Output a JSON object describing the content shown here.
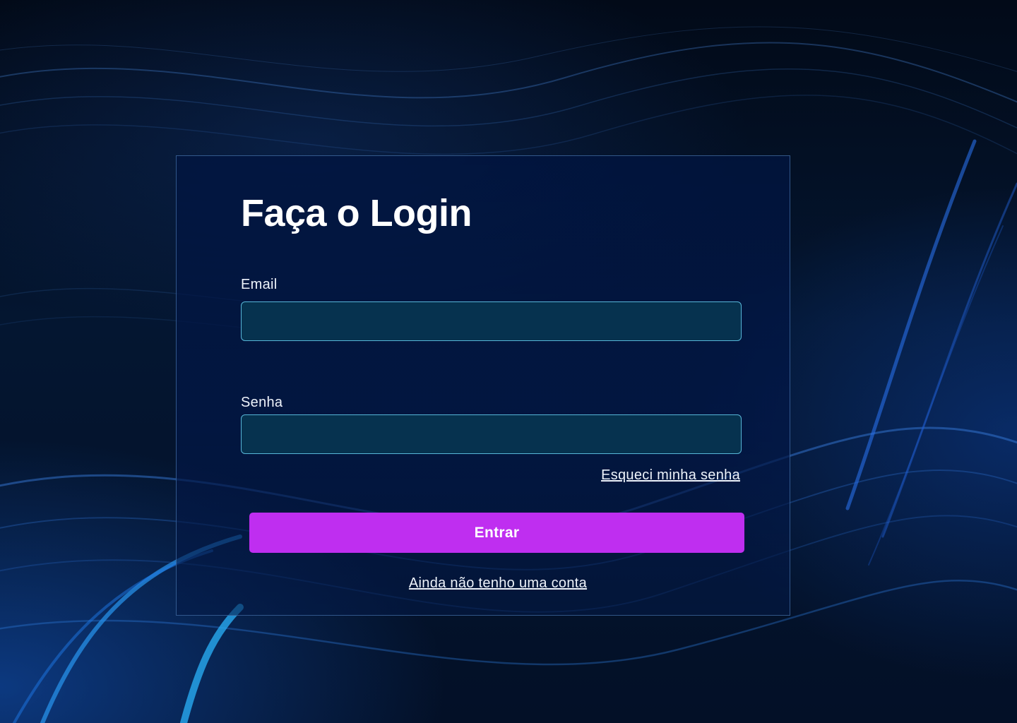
{
  "login": {
    "title": "Faça o Login",
    "email": {
      "label": "Email",
      "value": "",
      "placeholder": ""
    },
    "password": {
      "label": "Senha",
      "value": "",
      "placeholder": ""
    },
    "forgot_password_label": "Esqueci minha senha",
    "submit_label": "Entrar",
    "signup_label": "Ainda não tenho uma conta"
  },
  "colors": {
    "background": "#020d1e",
    "card_border": "#5a8cc8",
    "input_background": "#06324f",
    "input_border": "#57b6d8",
    "primary_button": "#bf2ef0",
    "text": "#ffffff"
  }
}
